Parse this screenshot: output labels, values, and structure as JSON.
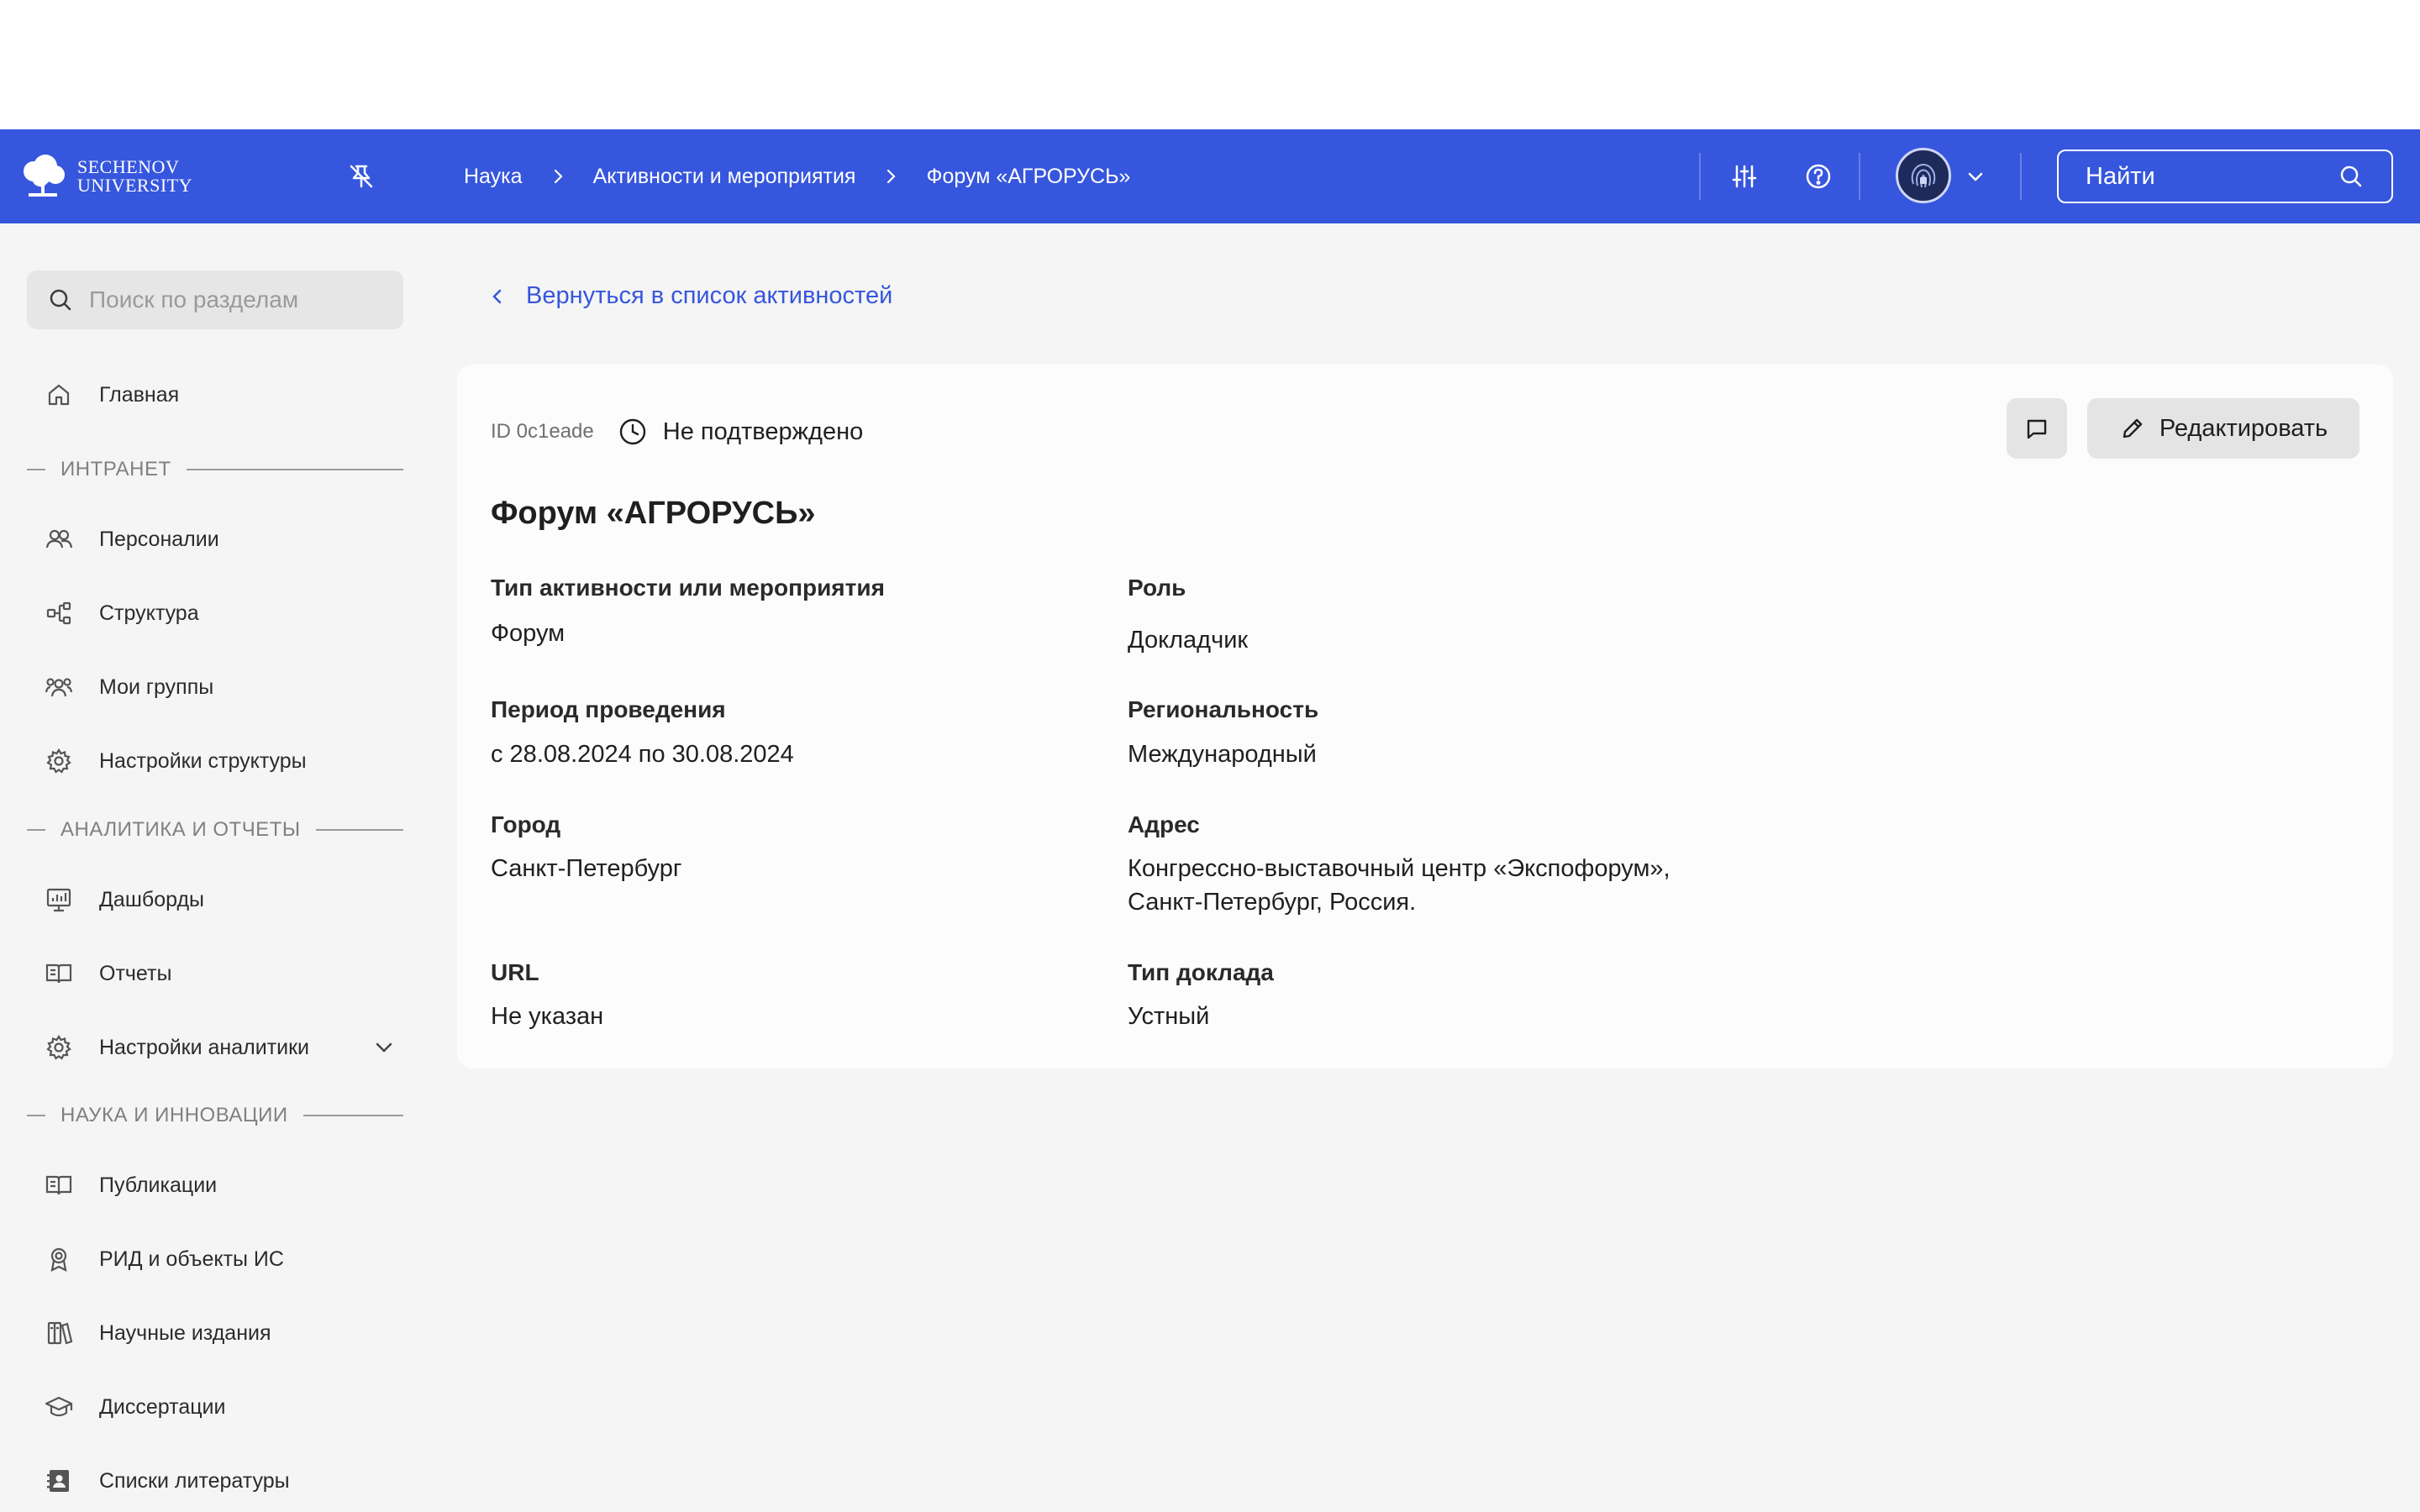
{
  "header": {
    "logo_line1": "SECHENOV",
    "logo_line2": "UNIVERSITY",
    "breadcrumbs": [
      "Наука",
      "Активности и мероприятия",
      "Форум «АГРОРУСЬ»"
    ],
    "search_placeholder": "Найти",
    "icons": [
      "pin-off-icon",
      "sliders-icon",
      "help-icon",
      "avatar",
      "chevron-down-icon",
      "search-icon"
    ]
  },
  "sidebar": {
    "search_placeholder": "Поиск по разделам",
    "home": "Главная",
    "sections": [
      {
        "title": "ИНТРАНЕТ",
        "items": [
          "Персоналии",
          "Структура",
          "Мои группы",
          "Настройки структуры"
        ]
      },
      {
        "title": "АНАЛИТИКА И ОТЧЕТЫ",
        "items": [
          "Дашборды",
          "Отчеты",
          "Настройки аналитики"
        ]
      },
      {
        "title": "НАУКА И ИННОВАЦИИ",
        "items": [
          "Публикации",
          "РИД и объекты ИС",
          "Научные издания",
          "Диссертации",
          "Списки литературы"
        ]
      }
    ]
  },
  "main": {
    "back_link": "Вернуться в список активностей",
    "card": {
      "id": "ID 0c1eade",
      "status": "Не подтверждено",
      "edit_label": "Редактировать",
      "title": "Форум «АГРОРУСЬ»",
      "fields": {
        "type_label": "Тип активности или мероприятия",
        "type_value": "Форум",
        "role_label": "Роль",
        "role_value": "Докладчик",
        "period_label": "Период проведения",
        "period_value": "с 28.08.2024 по 30.08.2024",
        "regional_label": "Региональность",
        "regional_value": "Международный",
        "city_label": "Город",
        "city_value": "Санкт-Петербург",
        "address_label": "Адрес",
        "address_line1": "Конгрессно-выставочный центр «Экспофорум»,",
        "address_line2": "Санкт-Петербург, Россия.",
        "url_label": "URL",
        "url_value": "Не указан",
        "report_label": "Тип доклада",
        "report_value": "Устный"
      }
    }
  },
  "colors": {
    "brand": "#3656dd",
    "background": "#f5f5f5",
    "card": "#fcfcfc",
    "button": "#e4e4e4"
  }
}
